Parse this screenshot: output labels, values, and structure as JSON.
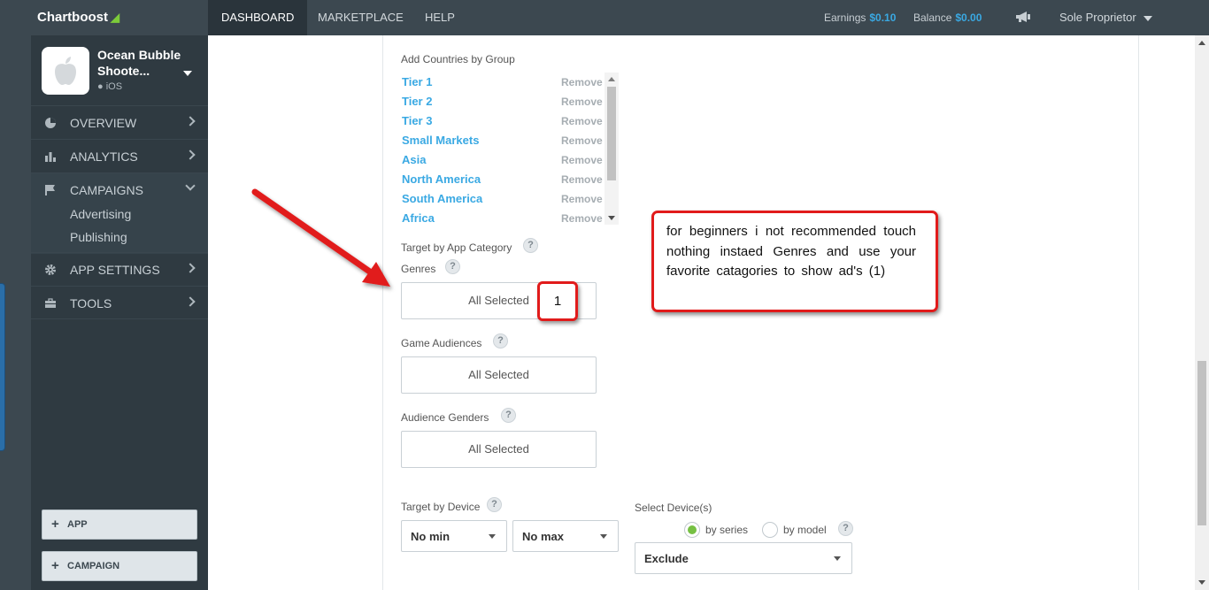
{
  "brand": "Chartboost",
  "nav": {
    "tabs": [
      "DASHBOARD",
      "MARKETPLACE",
      "HELP"
    ],
    "active": "DASHBOARD",
    "earnings_label": "Earnings",
    "earnings_value": "$0.10",
    "balance_label": "Balance",
    "balance_value": "$0.00",
    "account": "Sole Proprietor"
  },
  "sidebar": {
    "app_name": "Ocean Bubble Shoote...",
    "app_platform": "iOS",
    "items": [
      {
        "label": "OVERVIEW",
        "icon": "pie-chart-icon"
      },
      {
        "label": "ANALYTICS",
        "icon": "bar-chart-icon"
      },
      {
        "label": "CAMPAIGNS",
        "icon": "flag-icon"
      },
      {
        "label": "APP SETTINGS",
        "icon": "gear-icon"
      },
      {
        "label": "TOOLS",
        "icon": "briefcase-icon"
      }
    ],
    "campaign_subitems": [
      "Advertising",
      "Publishing"
    ],
    "buttons": [
      "APP",
      "CAMPAIGN"
    ]
  },
  "targeting": {
    "countries_label": "Add Countries by Group",
    "remove_label": "Remove",
    "countries": [
      "Tier 1",
      "Tier 2",
      "Tier 3",
      "Small Markets",
      "Asia",
      "North America",
      "South America",
      "Africa"
    ],
    "app_category_label": "Target by App Category",
    "genres_label": "Genres",
    "genres_value": "All Selected",
    "game_audiences_label": "Game Audiences",
    "game_audiences_value": "All Selected",
    "audience_genders_label": "Audience Genders",
    "audience_genders_value": "All Selected",
    "device_label": "Target by Device",
    "min_value": "No min",
    "max_value": "No max",
    "select_devices_label": "Select Device(s)",
    "by_series": "by series",
    "by_model": "by model",
    "selected_radio": "by series",
    "exclude_value": "Exclude",
    "help_glyph": "?"
  },
  "annotation": {
    "badge": "1",
    "callout": "for beginners i not recommended touch nothing instaed Genres and use your favorite catagories to show ad's (1)",
    "color": "#e11b1b"
  },
  "colors": {
    "accent": "#3aa9e3",
    "sidebar": "#2f3a41",
    "topbar": "#3c4850",
    "radio_on": "#76c043"
  }
}
